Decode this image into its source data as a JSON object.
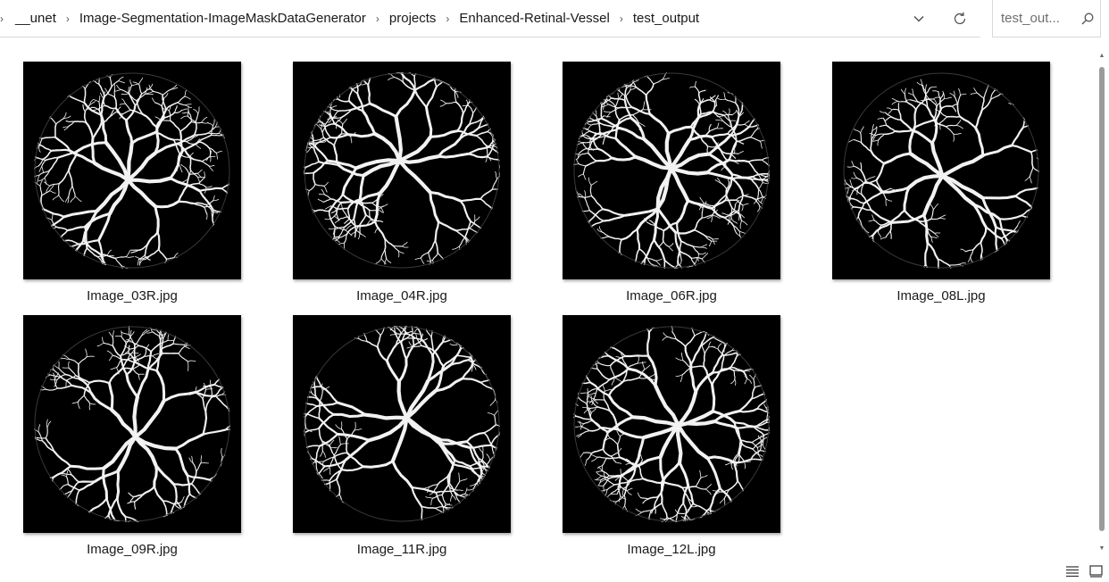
{
  "address": {
    "breadcrumbs": [
      "__unet",
      "Image-Segmentation-ImageMaskDataGenerator",
      "projects",
      "Enhanced-Retinal-Vessel",
      "test_output"
    ],
    "dropdown_icon": "chevron-down-icon",
    "refresh_icon": "refresh-icon"
  },
  "search": {
    "placeholder": "test_out...",
    "icon": "search-icon"
  },
  "files": [
    {
      "name": "Image_03R.jpg"
    },
    {
      "name": "Image_04R.jpg"
    },
    {
      "name": "Image_06R.jpg"
    },
    {
      "name": "Image_08L.jpg"
    },
    {
      "name": "Image_09R.jpg"
    },
    {
      "name": "Image_11R.jpg"
    },
    {
      "name": "Image_12L.jpg"
    }
  ],
  "view_buttons": [
    "details-view-icon",
    "large-icons-view-icon"
  ]
}
